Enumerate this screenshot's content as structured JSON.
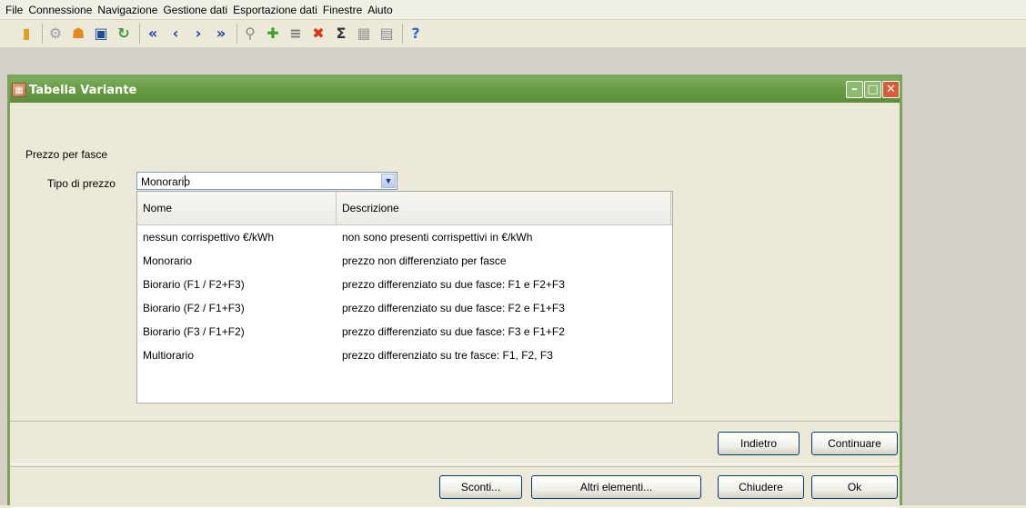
{
  "menu": [
    "File",
    "Connessione",
    "Navigazione",
    "Gestione dati",
    "Esportazione dati",
    "Finestre",
    "Aiuto"
  ],
  "toolbar": {
    "icons": [
      {
        "name": "exit-icon",
        "glyph": "▮",
        "color": "#e0a020"
      },
      {
        "name": "connect-icon",
        "glyph": "⚙",
        "color": "#9aa0b0"
      },
      {
        "name": "users-icon",
        "glyph": "☗",
        "color": "#e08a20"
      },
      {
        "name": "save-icon",
        "glyph": "▣",
        "color": "#1a4fa0"
      },
      {
        "name": "refresh-icon",
        "glyph": "↻",
        "color": "#3a9a3a"
      },
      {
        "name": "first-record-icon",
        "glyph": "«",
        "color": "#1a3fb0"
      },
      {
        "name": "previous-record-icon",
        "glyph": "‹",
        "color": "#1a3fb0"
      },
      {
        "name": "next-record-icon",
        "glyph": "›",
        "color": "#1a3fb0"
      },
      {
        "name": "last-record-icon",
        "glyph": "»",
        "color": "#1a3fb0"
      },
      {
        "name": "search-icon",
        "glyph": "⚲",
        "color": "#8a8a8a"
      },
      {
        "name": "add-icon",
        "glyph": "✚",
        "color": "#3aa02a"
      },
      {
        "name": "tree-icon",
        "glyph": "≡",
        "color": "#7a7a7a"
      },
      {
        "name": "delete-icon",
        "glyph": "✖",
        "color": "#e03010"
      },
      {
        "name": "sum-icon",
        "glyph": "Σ",
        "color": "#333333"
      },
      {
        "name": "calendar-icon",
        "glyph": "▦",
        "color": "#9a9a9a"
      },
      {
        "name": "export-icon",
        "glyph": "▤",
        "color": "#8a8a9a"
      },
      {
        "name": "help-icon",
        "glyph": "?",
        "color": "#2a6fd0"
      }
    ]
  },
  "window": {
    "title": "Tabella Variante",
    "minimize": "–",
    "maximize": "□",
    "close": "✕"
  },
  "form": {
    "section_label": "Prezzo per fasce",
    "price_type_label": "Tipo di prezzo",
    "price_type_value": "Monorario"
  },
  "list": {
    "headers": [
      "Nome",
      "Descrizione"
    ],
    "rows": [
      {
        "name": "nessun corrispettivo €/kWh",
        "desc": "non sono presenti corrispettivi in €/kWh"
      },
      {
        "name": "Monorario",
        "desc": "prezzo non differenziato per fasce"
      },
      {
        "name": "Biorario (F1 / F2+F3)",
        "desc": "prezzo differenziato su due fasce: F1 e F2+F3"
      },
      {
        "name": "Biorario (F2 / F1+F3)",
        "desc": "prezzo differenziato su due fasce: F2 e F1+F3"
      },
      {
        "name": "Biorario (F3 / F1+F2)",
        "desc": "prezzo differenziato su due fasce: F3 e F1+F2"
      },
      {
        "name": "Multiorario",
        "desc": "prezzo differenziato su tre fasce: F1, F2, F3"
      }
    ]
  },
  "buttons": {
    "back": "Indietro",
    "continue": "Continuare",
    "discounts": "Sconti...",
    "other_elements": "Altri elementi...",
    "close": "Chiudere",
    "ok": "Ok"
  }
}
